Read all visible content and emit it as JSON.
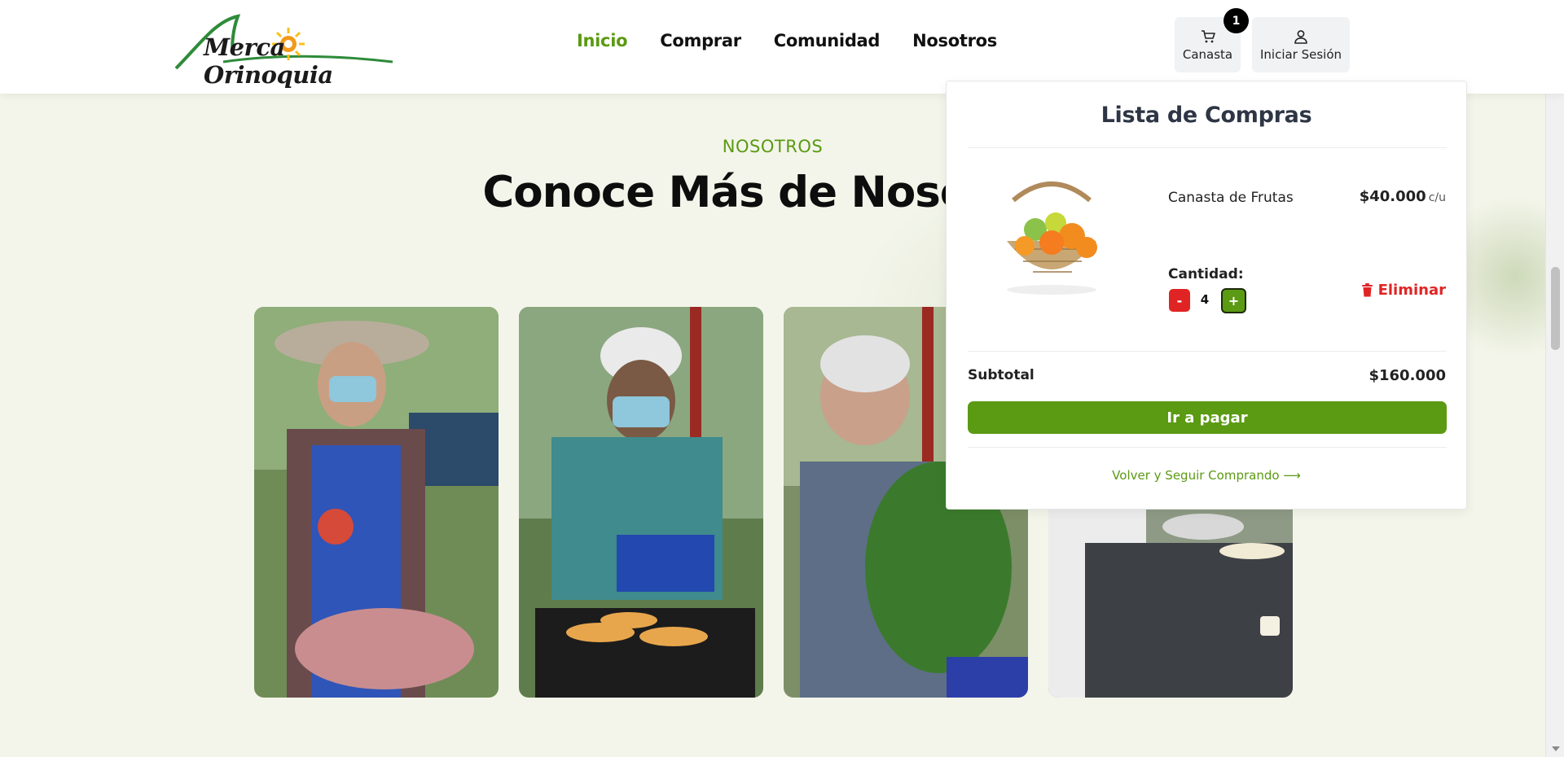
{
  "header": {
    "logo_text": "Merca Orinoquia",
    "nav": [
      "Inicio",
      "Comprar",
      "Comunidad",
      "Nosotros"
    ],
    "cart_label": "Canasta",
    "cart_count": "1",
    "login_label": "Iniciar Sesión"
  },
  "section": {
    "eyebrow": "NOSOTROS",
    "title": "Conoce Más de Nosotros"
  },
  "cart": {
    "title": "Lista de Compras",
    "item": {
      "name": "Canasta de Frutas",
      "price": "$40.000",
      "unit": "c/u",
      "quantity_label": "Cantidad:",
      "minus": "-",
      "quantity": "4",
      "plus": "+",
      "remove": "Eliminar"
    },
    "subtotal_label": "Subtotal",
    "subtotal_value": "$160.000",
    "pay_button": "Ir a pagar",
    "continue_link": "Volver y Seguir Comprando ⟶"
  },
  "colors": {
    "accent": "#5b9a13",
    "danger": "#e02424",
    "page_bg": "#f3f5ea"
  }
}
